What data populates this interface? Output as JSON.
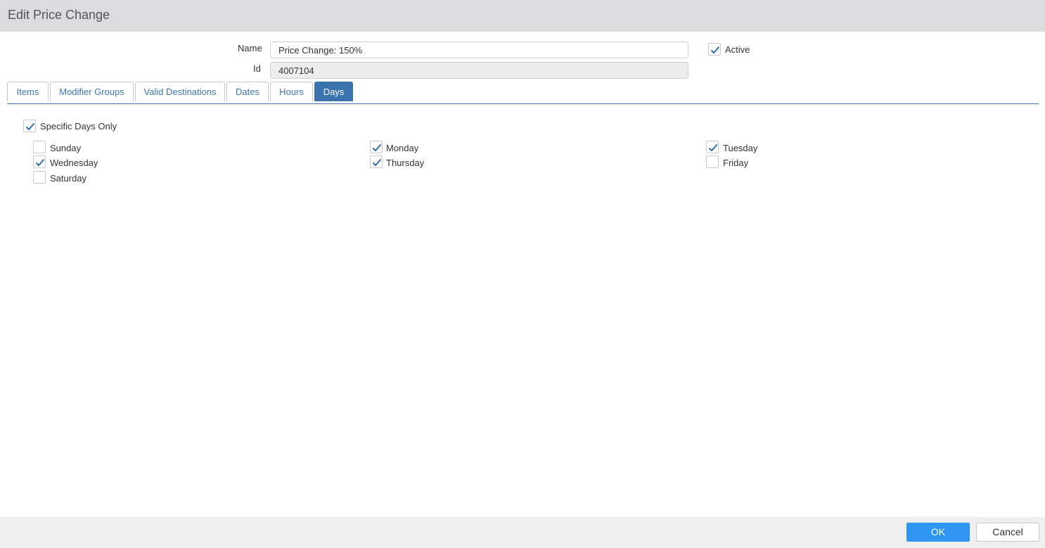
{
  "window": {
    "title": "Edit Price Change"
  },
  "form": {
    "name_label": "Name",
    "name_value": "Price Change: 150%",
    "id_label": "Id",
    "id_value": "4007104",
    "active_label": "Active",
    "active_checked": true
  },
  "tabs": [
    {
      "label": "Items",
      "active": false
    },
    {
      "label": "Modifier Groups",
      "active": false
    },
    {
      "label": "Valid Destinations",
      "active": false
    },
    {
      "label": "Dates",
      "active": false
    },
    {
      "label": "Hours",
      "active": false
    },
    {
      "label": "Days",
      "active": true
    }
  ],
  "days_panel": {
    "specific_label": "Specific Days Only",
    "specific_checked": true,
    "days": [
      {
        "label": "Sunday",
        "checked": false
      },
      {
        "label": "Monday",
        "checked": true
      },
      {
        "label": "Tuesday",
        "checked": true
      },
      {
        "label": "Wednesday",
        "checked": true
      },
      {
        "label": "Thursday",
        "checked": true
      },
      {
        "label": "Friday",
        "checked": false
      },
      {
        "label": "Saturday",
        "checked": false
      }
    ]
  },
  "footer": {
    "ok_label": "OK",
    "cancel_label": "Cancel"
  },
  "colors": {
    "accent": "#3a73ad",
    "ok_button": "#2e96f0",
    "check": "#2f6ea6"
  }
}
